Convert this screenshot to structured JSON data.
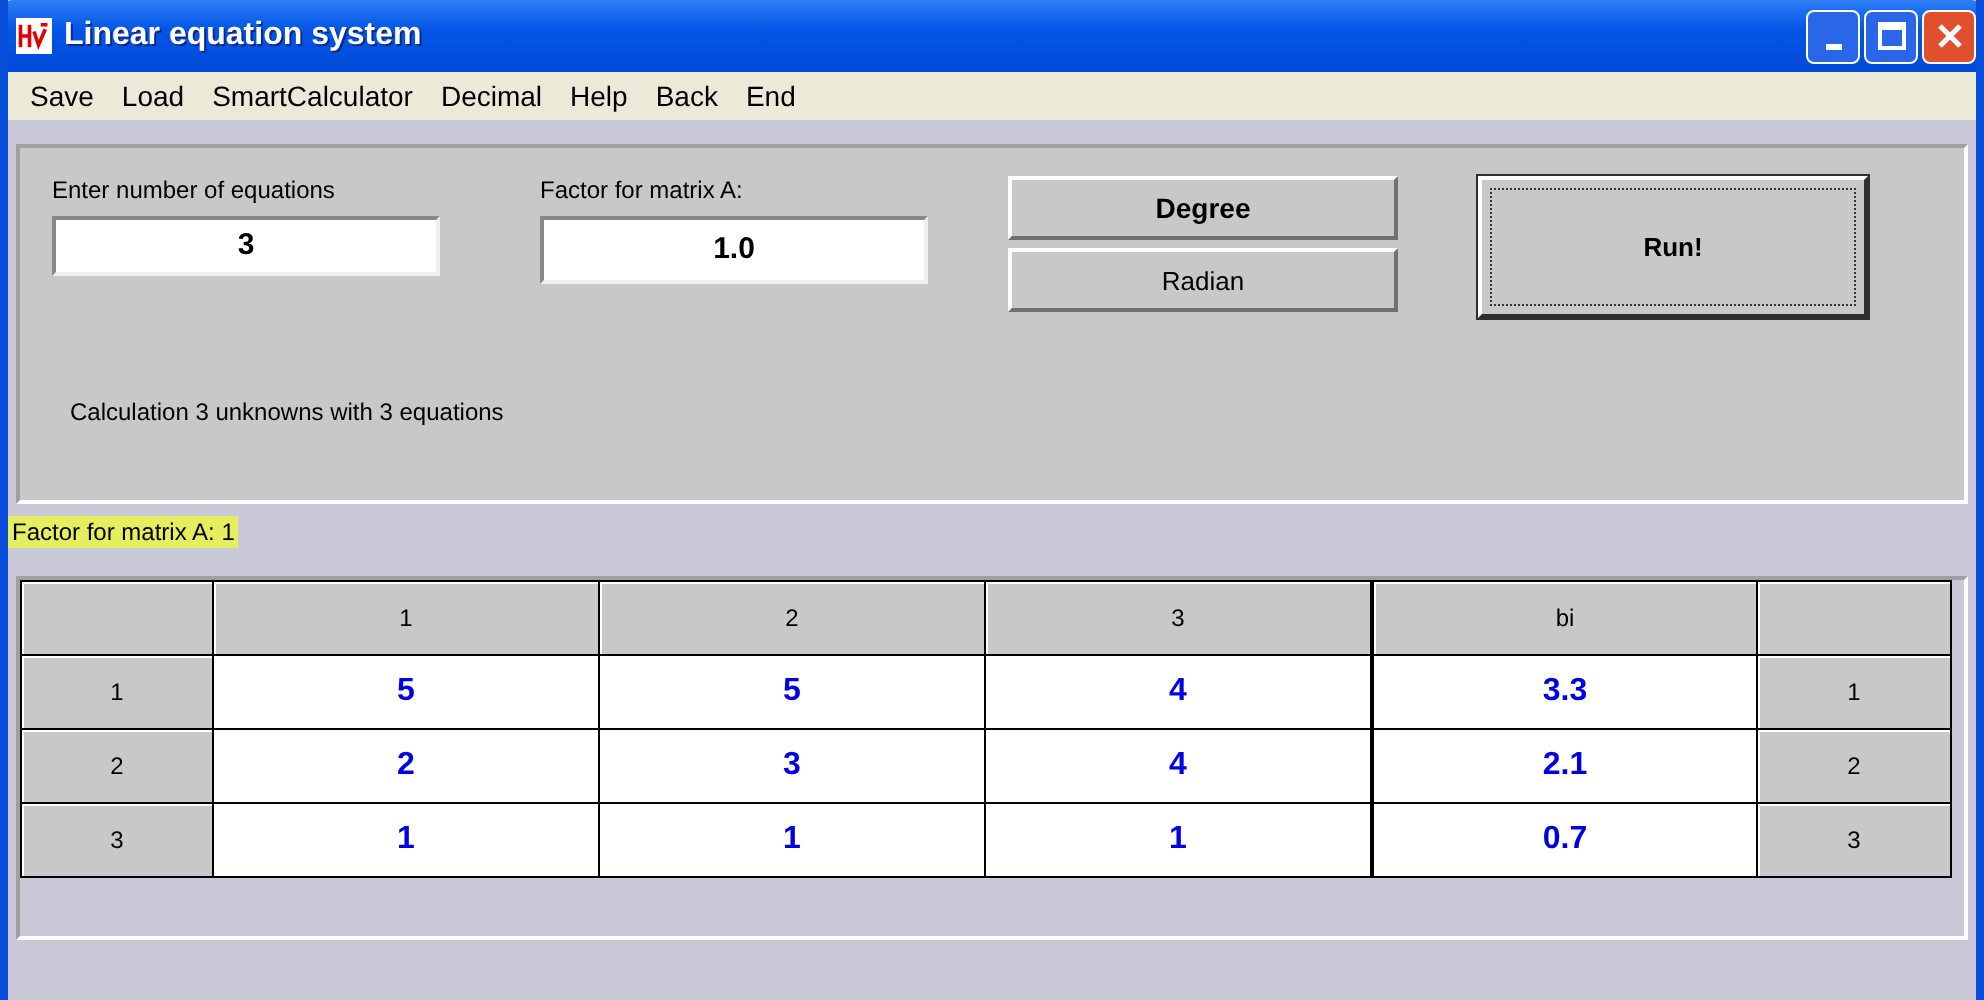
{
  "window": {
    "title": "Linear equation system"
  },
  "menu": [
    {
      "label": "Save"
    },
    {
      "label": "Load"
    },
    {
      "label": "SmartCalculator"
    },
    {
      "label": "Decimal"
    },
    {
      "label": "Help"
    },
    {
      "label": "Back"
    },
    {
      "label": "End"
    }
  ],
  "equations_field": {
    "label": "Enter number of equations",
    "value": "3"
  },
  "factor_field": {
    "label": "Factor for matrix A:",
    "value": "1.0"
  },
  "angle_buttons": [
    {
      "label": "Degree",
      "selected": true
    },
    {
      "label": "Radian",
      "selected": false
    }
  ],
  "run_button": {
    "label": "Run!"
  },
  "calculation_text": "Calculation  3 unknowns with  3 equations",
  "factor_note": "Factor for matrix A: 1",
  "table": {
    "columns": [
      "1",
      "2",
      "3",
      "bi"
    ],
    "rows": [
      {
        "label": "1",
        "values": [
          "5",
          "5",
          "4"
        ],
        "b": "3.3",
        "right_label": "1"
      },
      {
        "label": "2",
        "values": [
          "2",
          "3",
          "4"
        ],
        "b": "2.1",
        "right_label": "2"
      },
      {
        "label": "3",
        "values": [
          "1",
          "1",
          "1"
        ],
        "b": "0.7",
        "right_label": "3"
      }
    ]
  }
}
